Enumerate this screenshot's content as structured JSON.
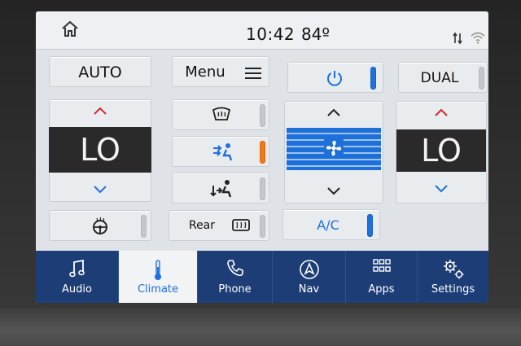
{
  "status": {
    "clock": "10:42",
    "temperature": "84º"
  },
  "controls": {
    "auto_label": "AUTO",
    "menu_label": "Menu",
    "dual_label": "DUAL",
    "ac_label": "A/C",
    "rear_label": "Rear",
    "left_temp": "LO",
    "right_temp": "LO"
  },
  "nav": {
    "items": [
      {
        "label": "Audio"
      },
      {
        "label": "Climate"
      },
      {
        "label": "Phone"
      },
      {
        "label": "Nav"
      },
      {
        "label": "Apps"
      },
      {
        "label": "Settings"
      }
    ],
    "active": "Climate"
  },
  "colors": {
    "accent": "#1f6fe0",
    "nav_bg": "#1c3d75",
    "indicator_orange": "#f07a1a",
    "temp_up": "#d0272f"
  },
  "icons": [
    "home-icon",
    "signal-icon",
    "wifi-icon",
    "menu-icon",
    "power-icon",
    "front-defrost-icon",
    "airflow-upper-icon",
    "airflow-lower-icon",
    "heated-steering-icon",
    "rear-defrost-icon",
    "fan-icon",
    "music-note-icon",
    "thermometer-icon",
    "phone-icon",
    "nav-arrow-icon",
    "apps-grid-icon",
    "gears-icon"
  ]
}
